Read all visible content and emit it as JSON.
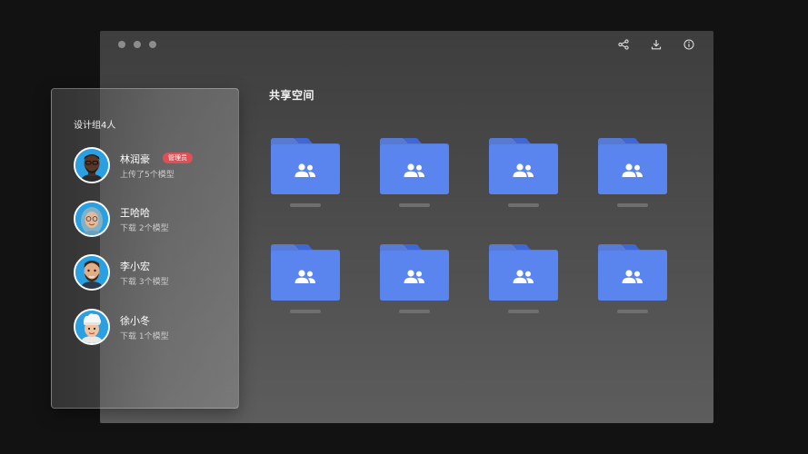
{
  "window": {
    "traffic_lights": [
      "dot",
      "dot",
      "dot"
    ],
    "toolbar": [
      {
        "icon": "share-icon"
      },
      {
        "icon": "download-icon"
      },
      {
        "icon": "info-icon"
      }
    ]
  },
  "space": {
    "title": "共享空间",
    "folder_color": "#5a84ee",
    "folders": [
      {
        "icon": "shared-folder-icon"
      },
      {
        "icon": "shared-folder-icon"
      },
      {
        "icon": "shared-folder-icon"
      },
      {
        "icon": "shared-folder-icon"
      },
      {
        "icon": "shared-folder-icon"
      },
      {
        "icon": "shared-folder-icon"
      },
      {
        "icon": "shared-folder-icon"
      },
      {
        "icon": "shared-folder-icon"
      }
    ]
  },
  "panel": {
    "title": "设计组4人",
    "members": [
      {
        "name": "林润豪",
        "badge": "管理员",
        "subtitle": "上传了5个模型",
        "avatar": "avatar-dark-man"
      },
      {
        "name": "王哈哈",
        "badge": "",
        "subtitle": "下载 2个模型",
        "avatar": "avatar-hijab-woman"
      },
      {
        "name": "李小宏",
        "badge": "",
        "subtitle": "下载 3个模型",
        "avatar": "avatar-bearded-man"
      },
      {
        "name": "徐小冬",
        "badge": "",
        "subtitle": "下载 1个模型",
        "avatar": "avatar-chef"
      }
    ]
  },
  "colors": {
    "badge": "#e04f55",
    "avatar_ring": "#ffffff",
    "avatar_bg": "#2a9fe1"
  }
}
